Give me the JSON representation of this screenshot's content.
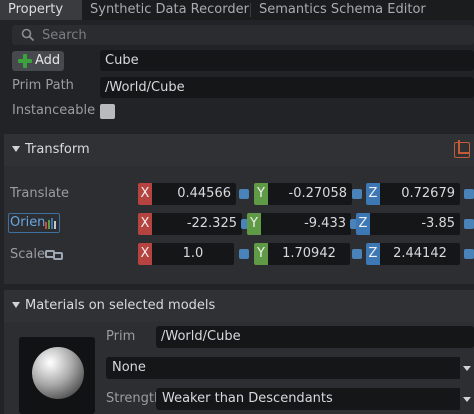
{
  "tabs": [
    {
      "label": "Property",
      "active": true
    },
    {
      "label": "Synthetic Data Recorder",
      "active": false
    },
    {
      "label": "Semantics Schema Editor",
      "active": false
    }
  ],
  "search": {
    "placeholder": "Search"
  },
  "prim": {
    "add_label": "Add",
    "name_value": "Cube",
    "path_label": "Prim Path",
    "path_value": "/World/Cube",
    "instanceable_label": "Instanceable",
    "instanceable_checked": false
  },
  "transform": {
    "title": "Transform",
    "rows": [
      {
        "label": "Translate",
        "x": "0.44566",
        "y": "-0.27058",
        "z": "0.72679"
      },
      {
        "label": "Orien",
        "x": "-22.325",
        "y": "-9.433",
        "z": "-3.85"
      },
      {
        "label": "Scale",
        "x": "1.0",
        "y": "1.70942",
        "z": "2.44142"
      }
    ],
    "axis_labels": {
      "x": "X",
      "y": "Y",
      "z": "Z"
    }
  },
  "materials": {
    "title": "Materials on selected models",
    "prim_label": "Prim",
    "prim_value": "/World/Cube",
    "material_value": "None",
    "strength_label": "Strength",
    "strength_value": "Weaker than Descendants"
  },
  "colors": {
    "x_axis": "#b5433f",
    "y_axis": "#5f9a46",
    "z_axis": "#3d77b4",
    "add_icon": "#3ca23c",
    "accent": "#4a83b9"
  }
}
